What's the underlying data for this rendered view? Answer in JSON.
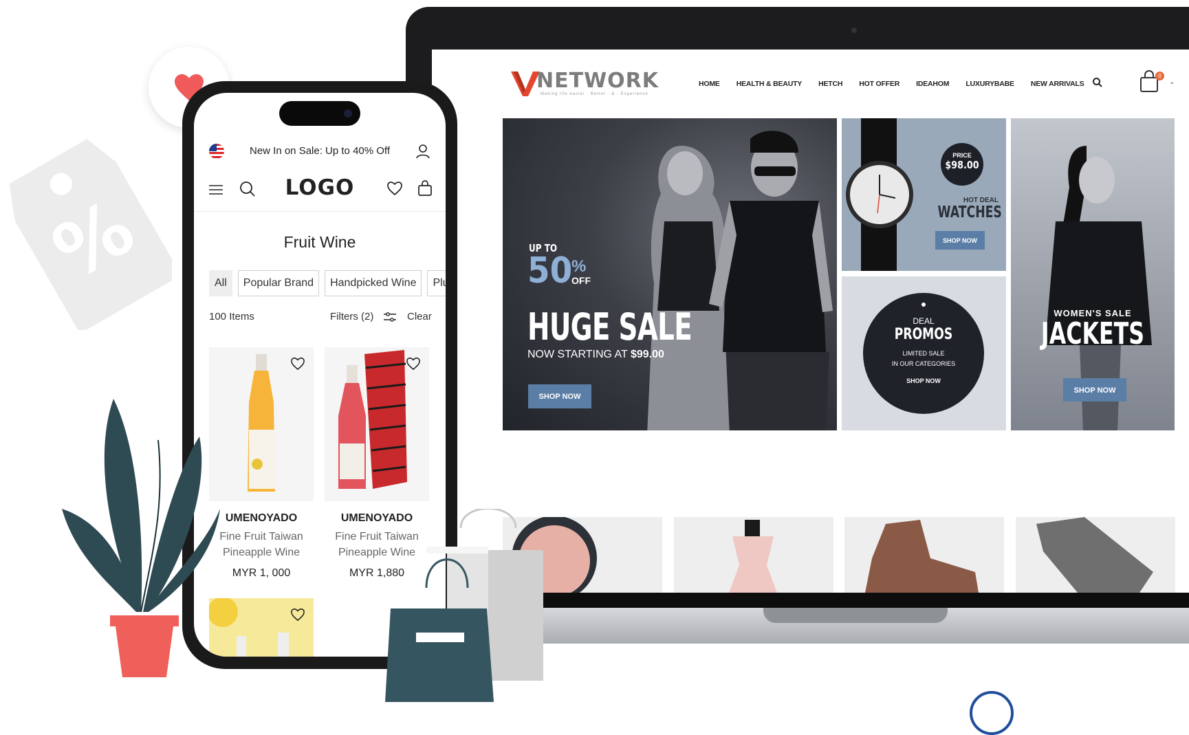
{
  "laptop": {
    "logo": {
      "mark": "V",
      "text": "NETWORK",
      "tagline": "Making life easier · Better · & · Experience"
    },
    "nav": [
      "HOME",
      "HEALTH & BEAUTY",
      "HETCH",
      "HOT OFFER",
      "IDEAHOM",
      "LUXURYBABE",
      "NEW ARRIVALS"
    ],
    "cart_count": "0",
    "hero": {
      "upto": "UP TO",
      "percent": "50",
      "percent_sign": "%",
      "off": "OFF",
      "title": "HUGE SALE",
      "subtitle_prefix": "NOW STARTING AT",
      "subtitle_price": "$99.00",
      "button": "SHOP NOW"
    },
    "watch_panel": {
      "price_label": "PRICE",
      "price": "$98.00",
      "hot": "HOT DEAL",
      "title": "WATCHES",
      "button": "SHOP NOW"
    },
    "promo_panel": {
      "deal": "DEAL",
      "title": "PROMOS",
      "line1": "LIMITED SALE",
      "line2": "IN OUR CATEGORIES",
      "button": "SHOP NOW"
    },
    "jacket_panel": {
      "sale": "WOMEN'S SALE",
      "title": "JACKETS",
      "button": "SHOP NOW"
    }
  },
  "phone": {
    "announcement": "New In on Sale: Up to 40% Off",
    "logo": "LOGO",
    "title": "Fruit Wine",
    "chips": [
      "All",
      "Popular Brand",
      "Handpicked Wine",
      "Plu"
    ],
    "item_count": "100 Items",
    "filters_label": "Filters (2)",
    "clear_label": "Clear",
    "products": [
      {
        "brand": "UMENOYADO",
        "name_line1": "Fine Fruit Taiwan",
        "name_line2": "Pineapple Wine",
        "price": "MYR 1, 000"
      },
      {
        "brand": "UMENOYADO",
        "name_line1": "Fine Fruit Taiwan",
        "name_line2": "Pineapple Wine",
        "price": "MYR 1,880"
      }
    ]
  },
  "colors": {
    "accent_blue": "#5b7ea6",
    "heart_red": "#f05a5a",
    "plant_dark": "#2e4a52",
    "pot_red": "#f0605a",
    "bag_dark": "#355660"
  }
}
